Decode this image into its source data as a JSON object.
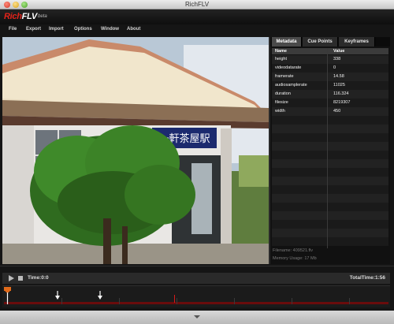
{
  "window": {
    "title": "RichFLV"
  },
  "app": {
    "logo_rich": "Rich",
    "logo_flv": "FLV",
    "beta_label": "beta"
  },
  "menu": {
    "items": [
      "File",
      "Export",
      "Import",
      "Options",
      "Window",
      "About"
    ]
  },
  "tabs": [
    {
      "label": "Metadata",
      "active": true
    },
    {
      "label": "Cue Points",
      "active": false
    },
    {
      "label": "Keyframes",
      "active": false
    }
  ],
  "metadata": {
    "headers": {
      "name": "Name",
      "value": "Value"
    },
    "rows": [
      {
        "name": "height",
        "value": "338"
      },
      {
        "name": "videodatarate",
        "value": "0"
      },
      {
        "name": "framerate",
        "value": "14.58"
      },
      {
        "name": "audiosamplerate",
        "value": "11025"
      },
      {
        "name": "duration",
        "value": "116.324"
      },
      {
        "name": "filesize",
        "value": "8219307"
      },
      {
        "name": "width",
        "value": "450"
      }
    ]
  },
  "status": {
    "filename": "Filename: 409521.flv",
    "memory": "Memory Usage: 17 Mb"
  },
  "video": {
    "sign_text": "一軒茶屋駅"
  },
  "player": {
    "time": "Time:0:0",
    "total_time": "TotalTime:1:56"
  },
  "colors": {
    "accent_red": "#e2231a",
    "timeline_red": "#6a0c0c",
    "panel_bg": "#151515"
  },
  "icons": {
    "play": "play-icon",
    "stop": "stop-icon",
    "keyframe": "arrow-down-icon",
    "playhead": "playhead-icon",
    "resize": "chevron-down-icon"
  }
}
